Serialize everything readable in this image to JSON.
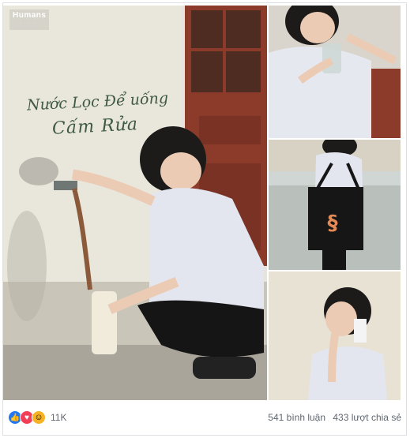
{
  "watermark": {
    "brand": "Humans",
    "sub": "· · ·"
  },
  "wall_text": {
    "line1": "Nước Lọc Để uống",
    "line2": "Cấm Rửa"
  },
  "footer": {
    "reaction_count": "11K",
    "comments": "541 bình luận",
    "shares": "433 lượt chia sẻ"
  },
  "icons": {
    "like": "thumbs-up-icon",
    "love": "heart-icon",
    "haha": "laugh-face-icon"
  },
  "colors": {
    "like": "#2078f4",
    "love": "#f33e58",
    "haha": "#f7b125",
    "wall_text": "#3e5a42"
  }
}
